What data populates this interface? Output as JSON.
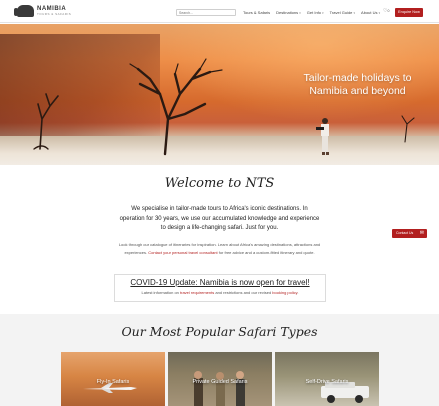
{
  "header": {
    "logo_name": "NAMIBIA",
    "logo_sub": "TOURS & SAFARIS",
    "search_placeholder": "Search...",
    "nav": [
      {
        "label": "Tours & Safaris",
        "dropdown": false
      },
      {
        "label": "Destinations",
        "dropdown": true
      },
      {
        "label": "Get Info",
        "dropdown": true
      },
      {
        "label": "Travel Guide",
        "dropdown": true
      },
      {
        "label": "About Us",
        "dropdown": true
      }
    ],
    "cart_count": "0",
    "enquire_label": "Enquire Now"
  },
  "hero": {
    "title_line1": "Tailor-made holidays to",
    "title_line2": "Namibia and beyond"
  },
  "welcome": {
    "title": "Welcome to NTS",
    "lead": "We specialise in tailor-made tours to Africa's iconic destinations. In operation for 30 years, we use our accumulated knowledge and experience to design a life-changing safari. Just for you.",
    "body_prefix": "Look through our catalogue of itineraries for inspiration. Learn about Africa's amazing destinations, attractions and experiences. ",
    "body_link": "Contact your personal travel consultant",
    "body_suffix": " for free advice and a custom-fitted itinerary and quote."
  },
  "contact_tab": {
    "label": "Contact Us"
  },
  "covid": {
    "title": "COVID-19 Update: Namibia is now open for travel!",
    "sub_prefix": "Latest information on ",
    "sub_link1": "travel requirements",
    "sub_middle": " and restrictions and our revised ",
    "sub_link2": "booking policy",
    "sub_suffix": "."
  },
  "popular": {
    "title": "Our Most Popular Safari Types",
    "cards": [
      {
        "label": "Fly-In Safaris"
      },
      {
        "label": "Private Guided Safaris"
      },
      {
        "label": "Self-Drive Safaris"
      }
    ]
  },
  "colors": {
    "brand_red": "#b21f1f",
    "section_bg": "#f3f3f3"
  },
  "icons": {
    "logo": "elephant-icon",
    "cart": "heart-icon",
    "contact": "mail-icon"
  }
}
